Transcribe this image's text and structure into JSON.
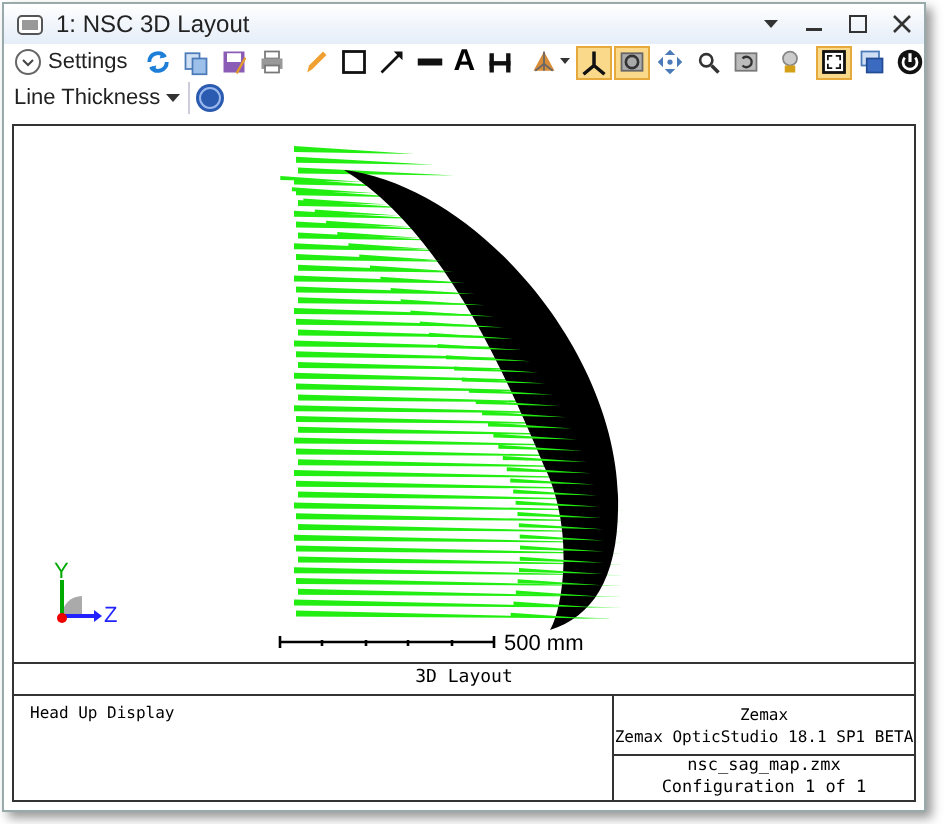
{
  "window": {
    "title": "1: NSC 3D Layout"
  },
  "toolbar": [
    {
      "kind": "settings",
      "label": "Settings",
      "selected": false
    },
    {
      "kind": "sep"
    },
    {
      "kind": "icon",
      "selected": false
    },
    {
      "kind": "icon",
      "selected": false
    },
    {
      "kind": "icon",
      "selected": false
    },
    {
      "kind": "icon",
      "selected": false
    },
    {
      "kind": "sep"
    },
    {
      "kind": "icon",
      "selected": false
    },
    {
      "kind": "icon",
      "selected": false
    },
    {
      "kind": "icon",
      "selected": false
    },
    {
      "kind": "icon",
      "selected": false
    },
    {
      "kind": "text",
      "label": "A",
      "selected": false
    },
    {
      "kind": "icon",
      "selected": false
    },
    {
      "kind": "sep"
    },
    {
      "kind": "icon",
      "selected": false,
      "dropdown": true
    },
    {
      "kind": "icon",
      "selected": true
    },
    {
      "kind": "icon",
      "selected": true
    },
    {
      "kind": "icon",
      "selected": false
    },
    {
      "kind": "icon",
      "selected": false
    },
    {
      "kind": "icon",
      "selected": false
    },
    {
      "kind": "sep"
    },
    {
      "kind": "icon",
      "selected": false
    },
    {
      "kind": "sep"
    },
    {
      "kind": "icon",
      "selected": true
    },
    {
      "kind": "icon",
      "selected": false
    },
    {
      "kind": "icon",
      "selected": false
    }
  ],
  "toolbar2": {
    "dropdown": "Line Thickness"
  },
  "plot": {
    "scale_label": "500 mm",
    "axes": {
      "vertical": "Y",
      "horizontal": "Z"
    }
  },
  "footer": {
    "title": "3D Layout",
    "note": "Head Up Display",
    "company": "Zemax",
    "product": "Zemax OpticStudio 18.1 SP1 BETA",
    "file": "nsc_sag_map.zmx",
    "configuration": "Configuration 1 of 1"
  }
}
